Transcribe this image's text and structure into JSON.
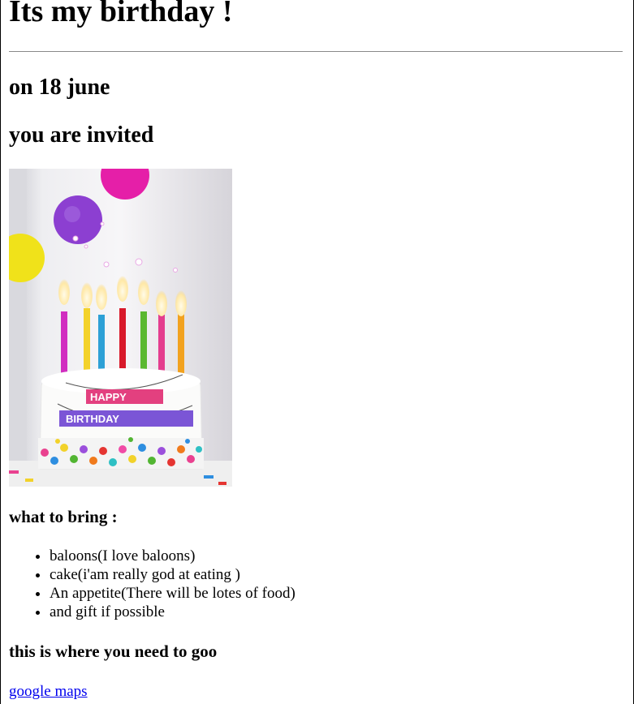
{
  "page": {
    "title": "Its my birthday !",
    "date_line": "on 18 june",
    "invite_line": "you are invited",
    "image": {
      "description_icon": "birthday-cake-image",
      "banner_text": "HAPPY BIRTHDAY"
    },
    "bring_heading": "what to bring :",
    "bring_items": [
      "baloons(I love baloons)",
      "cake(i'am really god at eating )",
      "An appetite(There will be lotes of food)",
      "and gift if possible"
    ],
    "where_heading": "this is where you need to goo",
    "maps_link": "google maps",
    "colors": {
      "link": "#0000ee",
      "text": "#000000",
      "rule": "#8a8a8a"
    }
  }
}
